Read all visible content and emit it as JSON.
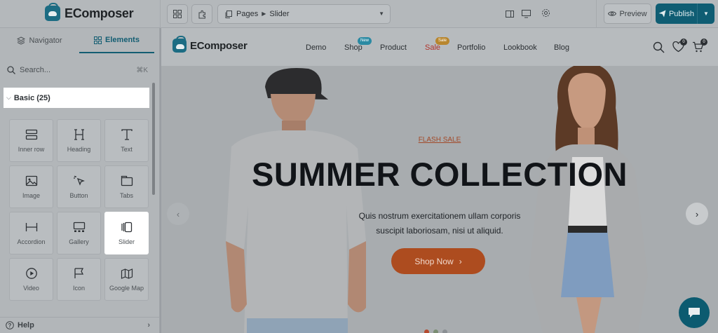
{
  "app": {
    "name": "EComposer"
  },
  "toolbar": {
    "page_path": "Pages",
    "page_name": "Slider",
    "preview_label": "Preview",
    "publish_label": "Publish"
  },
  "sidebar": {
    "tabs": [
      {
        "label": "Navigator"
      },
      {
        "label": "Elements"
      }
    ],
    "search_placeholder": "Search...",
    "search_shortcut": "⌘K",
    "category": "Basic (25)",
    "elements": [
      {
        "label": "Inner row",
        "icon": "inner-row-icon"
      },
      {
        "label": "Heading",
        "icon": "heading-icon"
      },
      {
        "label": "Text",
        "icon": "text-icon"
      },
      {
        "label": "Image",
        "icon": "image-icon"
      },
      {
        "label": "Button",
        "icon": "button-icon"
      },
      {
        "label": "Tabs",
        "icon": "tabs-icon"
      },
      {
        "label": "Accordion",
        "icon": "accordion-icon"
      },
      {
        "label": "Gallery",
        "icon": "gallery-icon"
      },
      {
        "label": "Slider",
        "icon": "slider-icon"
      },
      {
        "label": "Video",
        "icon": "video-icon"
      },
      {
        "label": "Icon",
        "icon": "flag-icon"
      },
      {
        "label": "Google Map",
        "icon": "map-icon"
      }
    ],
    "help_label": "Help"
  },
  "site": {
    "logo": "EComposer",
    "nav": [
      {
        "label": "Demo"
      },
      {
        "label": "Shop",
        "badge": "New"
      },
      {
        "label": "Product"
      },
      {
        "label": "Sale",
        "badge": "Sale"
      },
      {
        "label": "Portfolio"
      },
      {
        "label": "Lookbook"
      },
      {
        "label": "Blog"
      }
    ],
    "wishlist_count": "0",
    "cart_count": "0"
  },
  "hero": {
    "eyebrow": "FLASH SALE",
    "headline": "SUMMER COLLECTION",
    "sub_line1": "Quis nostrum exercitationem ullam corporis",
    "sub_line2": "suscipit laboriosam, nisi ut aliquid.",
    "cta": "Shop Now"
  },
  "colors": {
    "brand": "#1c6c83",
    "publish": "#0f5d73",
    "cta": "#ad4c1f",
    "sale": "#b0322a"
  }
}
